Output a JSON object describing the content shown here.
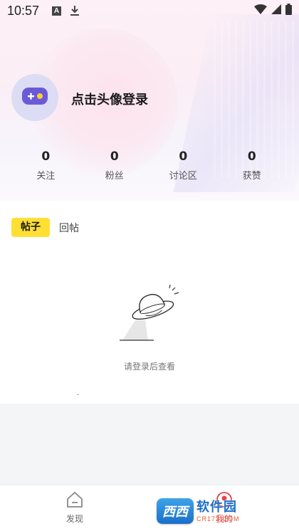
{
  "status_bar": {
    "time": "10:57",
    "notification_letter": "A"
  },
  "profile": {
    "login_prompt": "点击头像登录"
  },
  "stats": [
    {
      "value": "0",
      "label": "关注"
    },
    {
      "value": "0",
      "label": "粉丝"
    },
    {
      "value": "0",
      "label": "讨论区"
    },
    {
      "value": "0",
      "label": "获赞"
    }
  ],
  "content": {
    "tabs": [
      {
        "label": "帖子",
        "active": true
      },
      {
        "label": "回帖",
        "active": false
      }
    ],
    "empty_message": "请登录后查看"
  },
  "bottom_nav": {
    "items": [
      {
        "label": "发现",
        "icon": "home-icon"
      },
      {
        "label": "我的",
        "icon": "profile-icon"
      }
    ]
  },
  "watermark": {
    "badge_text": "西西",
    "name": "软件园",
    "url": "CR173.COM"
  },
  "colors": {
    "accent_yellow": "#ffdf33",
    "active_red": "#e8414a",
    "avatar_bg": "#dcdcf5",
    "avatar_icon": "#6a5ad8"
  }
}
